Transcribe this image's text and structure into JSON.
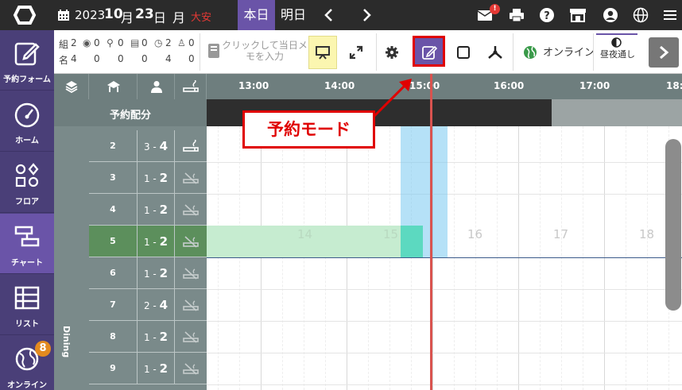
{
  "topbar": {
    "year": "2023",
    "month": "10",
    "month_unit": "月",
    "day": "23",
    "day_unit": "日",
    "weekday": "月",
    "rokuyo": "大安",
    "today_label": "本日",
    "tomorrow_label": "明日",
    "mail_badge": "!",
    "icons": [
      "logo-icon",
      "calendar-icon",
      "prev-day-icon",
      "next-day-icon",
      "mail-icon",
      "print-icon",
      "help-icon",
      "store-icon",
      "account-icon",
      "language-icon",
      "menu-icon"
    ]
  },
  "sidebar": {
    "items": [
      {
        "label": "予約フォーム",
        "icon": "edit-form-icon"
      },
      {
        "label": "ホーム",
        "icon": "dashboard-icon"
      },
      {
        "label": "フロア",
        "icon": "floor-icon"
      },
      {
        "label": "チャート",
        "icon": "chart-icon"
      },
      {
        "label": "リスト",
        "icon": "list-icon"
      },
      {
        "label": "オンライン",
        "icon": "globe-icon"
      }
    ],
    "online_badge": "8",
    "active": "チャート"
  },
  "toolbar": {
    "stats_row1": {
      "label": "組",
      "count": "2",
      "values": [
        "0",
        "0",
        "0",
        "2",
        "0"
      ]
    },
    "stats_row2": {
      "label": "名",
      "count": "4",
      "values": [
        "0",
        "0",
        "0",
        "4",
        "0"
      ]
    },
    "memo_placeholder": "クリックして当日メモを入力",
    "online_status": "オンライン",
    "day_night": "昼夜通し"
  },
  "chart": {
    "header_icons": [
      "layers-icon",
      "table-type-icon",
      "person-icon",
      "smoking-icon"
    ],
    "allocation_label": "予約配分",
    "times": [
      "13:00",
      "14:00",
      "15:00",
      "16:00",
      "17:00",
      "18:"
    ],
    "area_label": "Dining",
    "rows": [
      {
        "table": "2",
        "cap_min": "3",
        "cap_max": "4",
        "smoking": true
      },
      {
        "table": "3",
        "cap_min": "1",
        "cap_max": "2",
        "smoking": false
      },
      {
        "table": "4",
        "cap_min": "1",
        "cap_max": "2",
        "smoking": false
      },
      {
        "table": "5",
        "cap_min": "1",
        "cap_max": "2",
        "smoking": false
      },
      {
        "table": "6",
        "cap_min": "1",
        "cap_max": "2",
        "smoking": false
      },
      {
        "table": "7",
        "cap_min": "2",
        "cap_max": "4",
        "smoking": false
      },
      {
        "table": "8",
        "cap_min": "1",
        "cap_max": "2",
        "smoking": false
      },
      {
        "table": "9",
        "cap_min": "1",
        "cap_max": "2",
        "smoking": false
      }
    ],
    "ghost_hours": [
      "14",
      "15",
      "16",
      "17",
      "18"
    ]
  },
  "annotation": {
    "callout": "予約モード",
    "color": "#e00000"
  },
  "colors": {
    "brand": "#6a54a8",
    "sidebar": "#4a3f78",
    "header": "#6e7e7e",
    "accent": "#e53935"
  }
}
